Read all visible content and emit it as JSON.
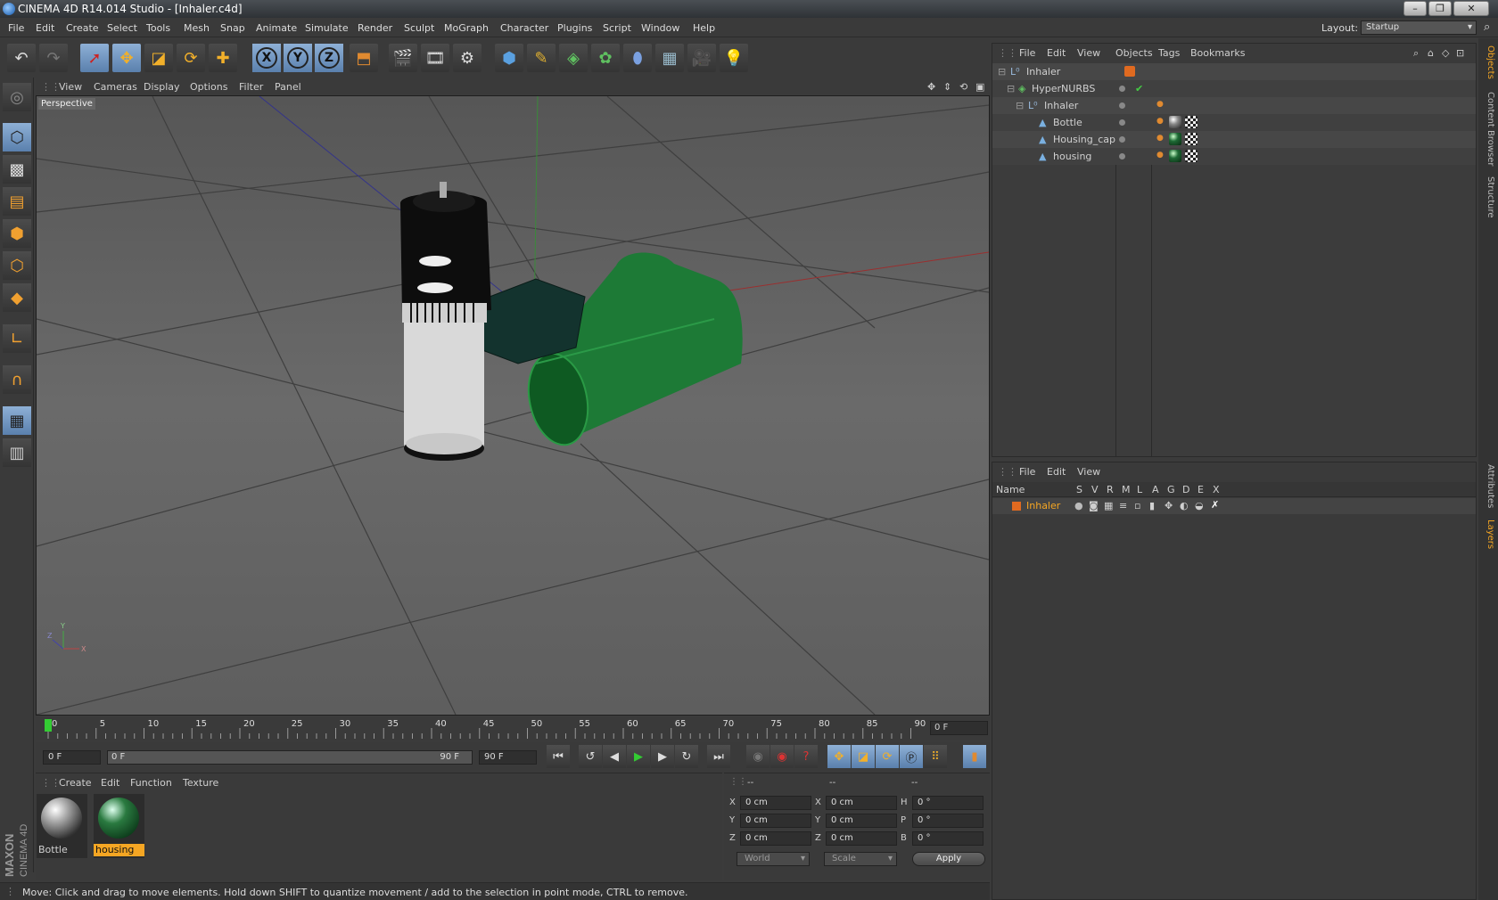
{
  "window": {
    "title": "CINEMA 4D R14.014 Studio - [Inhaler.c4d]"
  },
  "menu": [
    "File",
    "Edit",
    "Create",
    "Select",
    "Tools",
    "Mesh",
    "Snap",
    "Animate",
    "Simulate",
    "Render",
    "Sculpt",
    "MoGraph",
    "Character",
    "Plugins",
    "Script",
    "Window",
    "Help"
  ],
  "layout": {
    "label": "Layout:",
    "value": "Startup"
  },
  "toolbar_icons": [
    "undo-icon",
    "redo-icon",
    "live-select-icon",
    "move-icon",
    "scale-icon",
    "rotate-icon",
    "add-icon",
    "x-axis-icon",
    "y-axis-icon",
    "z-axis-icon",
    "coordinate-system-icon",
    "render-view-icon",
    "render-picture-viewer-icon",
    "render-settings-icon",
    "cube-icon",
    "spline-pen-icon",
    "subdivision-icon",
    "array-icon",
    "deformer-icon",
    "floor-icon",
    "camera-icon",
    "light-icon"
  ],
  "toolbar_axis": {
    "x": "X",
    "y": "Y",
    "z": "Z"
  },
  "viewport": {
    "menu": [
      "View",
      "Cameras",
      "Display",
      "Options",
      "Filter",
      "Panel"
    ],
    "label": "Perspective",
    "axis": {
      "x": "X",
      "y": "Y",
      "z": "Z"
    }
  },
  "timeline": {
    "ticks": [
      "0",
      "5",
      "10",
      "15",
      "20",
      "25",
      "30",
      "35",
      "40",
      "45",
      "50",
      "55",
      "60",
      "65",
      "70",
      "75",
      "80",
      "85",
      "90"
    ],
    "current": "0 F"
  },
  "transport": {
    "start": "0 F",
    "range_start": "0 F",
    "range_end": "90 F",
    "end": "90 F"
  },
  "material_manager": {
    "menu": [
      "Create",
      "Edit",
      "Function",
      "Texture"
    ],
    "materials": [
      {
        "name": "Bottle",
        "color": "#c8c8c8",
        "selected": false
      },
      {
        "name": "housing",
        "color": "#1e6a35",
        "selected": true
      }
    ]
  },
  "coordinates": {
    "headers": [
      "--",
      "--",
      "--"
    ],
    "rows": [
      {
        "a": "X",
        "v1": "0 cm",
        "b": "X",
        "v2": "0 cm",
        "c": "H",
        "v3": "0 °"
      },
      {
        "a": "Y",
        "v1": "0 cm",
        "b": "Y",
        "v2": "0 cm",
        "c": "P",
        "v3": "0 °"
      },
      {
        "a": "Z",
        "v1": "0 cm",
        "b": "Z",
        "v2": "0 cm",
        "c": "B",
        "v3": "0 °"
      }
    ],
    "mode1": "World",
    "mode2": "Scale",
    "apply": "Apply"
  },
  "status": "Move: Click and drag to move elements. Hold down SHIFT to quantize movement / add to the selection in point mode, CTRL to remove.",
  "object_manager": {
    "menu": [
      "File",
      "Edit",
      "View",
      "Objects",
      "Tags",
      "Bookmarks"
    ],
    "objects": [
      {
        "name": "Inhaler",
        "level": 0
      },
      {
        "name": "HyperNURBS",
        "level": 1
      },
      {
        "name": "Inhaler",
        "level": 2
      },
      {
        "name": "Bottle",
        "level": 3
      },
      {
        "name": "Housing_cap",
        "level": 3
      },
      {
        "name": "housing",
        "level": 3
      }
    ]
  },
  "layer_manager": {
    "menu": [
      "File",
      "Edit",
      "View"
    ],
    "columns": [
      "Name",
      "S",
      "V",
      "R",
      "M",
      "L",
      "A",
      "G",
      "D",
      "E",
      "X"
    ],
    "layers": [
      {
        "name": "Inhaler",
        "color": "#e06a20"
      }
    ]
  },
  "right_tabs": [
    "Objects",
    "Content Browser",
    "Structure",
    "Attributes",
    "Layers"
  ],
  "brand": {
    "maxon": "MAXON",
    "product": "CINEMA 4D"
  }
}
